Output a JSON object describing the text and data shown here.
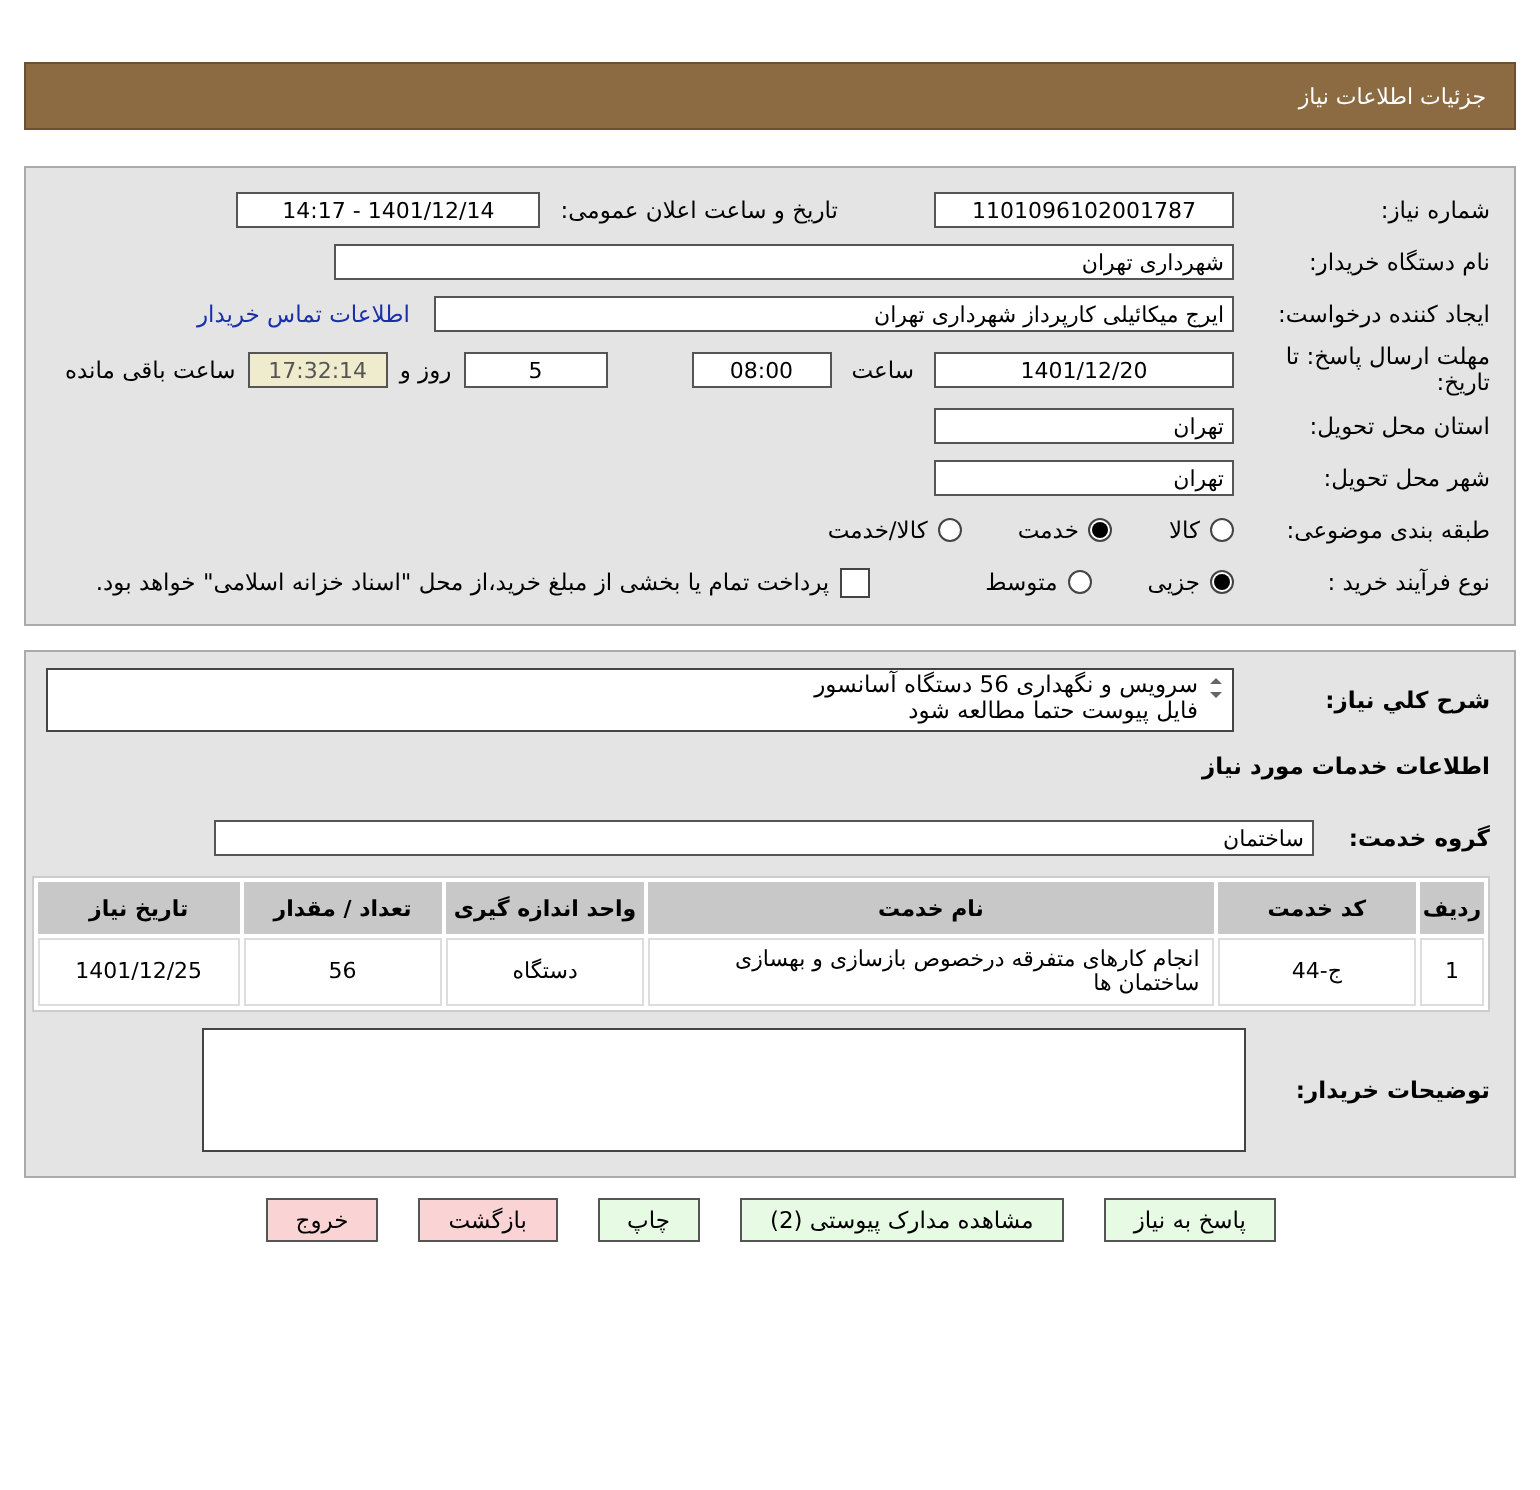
{
  "header": {
    "title": "جزئیات اطلاعات نیاز"
  },
  "details": {
    "need_number": {
      "label": "شماره نیاز:",
      "value": "1101096102001787"
    },
    "announce": {
      "label": "تاریخ و ساعت اعلان عمومی:",
      "value": "1401/12/14 - 14:17"
    },
    "buyer_org": {
      "label": "نام دستگاه خریدار:",
      "value": "شهرداری تهران"
    },
    "requester": {
      "label": "ایجاد کننده درخواست:",
      "value": "ایرج میکائیلی کارپرداز شهرداری تهران",
      "link": "اطلاعات تماس خریدار"
    },
    "deadline": {
      "label": "مهلت ارسال پاسخ: تا تاریخ:",
      "date": "1401/12/20",
      "time_label": "ساعت",
      "time": "08:00",
      "days": "5",
      "days_label": "روز و",
      "remaining": "17:32:14",
      "remaining_label": "ساعت باقی مانده"
    },
    "province": {
      "label": "استان محل تحویل:",
      "value": "تهران"
    },
    "city": {
      "label": "شهر محل تحویل:",
      "value": "تهران"
    },
    "category": {
      "label": "طبقه بندی موضوعی:",
      "options": [
        {
          "label": "کالا",
          "selected": false
        },
        {
          "label": "خدمت",
          "selected": true
        },
        {
          "label": "کالا/خدمت",
          "selected": false
        }
      ]
    },
    "purchase_type": {
      "label": "نوع فرآیند خرید :",
      "options": [
        {
          "label": "جزیی",
          "selected": true
        },
        {
          "label": "متوسط",
          "selected": false
        }
      ],
      "payment_note": {
        "label": "پرداخت تمام یا بخشی از مبلغ خرید،از محل \"اسناد خزانه اسلامی\" خواهد بود.",
        "checked": false
      }
    }
  },
  "needs": {
    "description": {
      "label": "شرح کلي نیاز:",
      "text": "سرویس و نگهداری 56 دستگاه آسانسور\nفایل پیوست حتما مطالعه شود"
    },
    "services_heading": "اطلاعات خدمات مورد نیاز",
    "service_group": {
      "label": "گروه خدمت:",
      "value": "ساختمان"
    },
    "table": {
      "columns": [
        "ردیف",
        "کد خدمت",
        "نام خدمت",
        "واحد اندازه گیری",
        "تعداد / مقدار",
        "تاریخ نیاز"
      ],
      "rows": [
        [
          "1",
          "ج-44",
          "انجام کارهای متفرقه درخصوص بازسازی و بهسازی ساختمان ها",
          "دستگاه",
          "56",
          "1401/12/25"
        ]
      ]
    },
    "buyer_notes": {
      "label": "توضیحات خریدار:"
    }
  },
  "buttons": [
    {
      "label": "پاسخ به نیاز",
      "kind": "green"
    },
    {
      "label": "مشاهده مدارک پیوستی (2)",
      "kind": "green"
    },
    {
      "label": "چاپ",
      "kind": "green"
    },
    {
      "label": "بازگشت",
      "kind": "pink"
    },
    {
      "label": "خروج",
      "kind": "pink"
    }
  ]
}
